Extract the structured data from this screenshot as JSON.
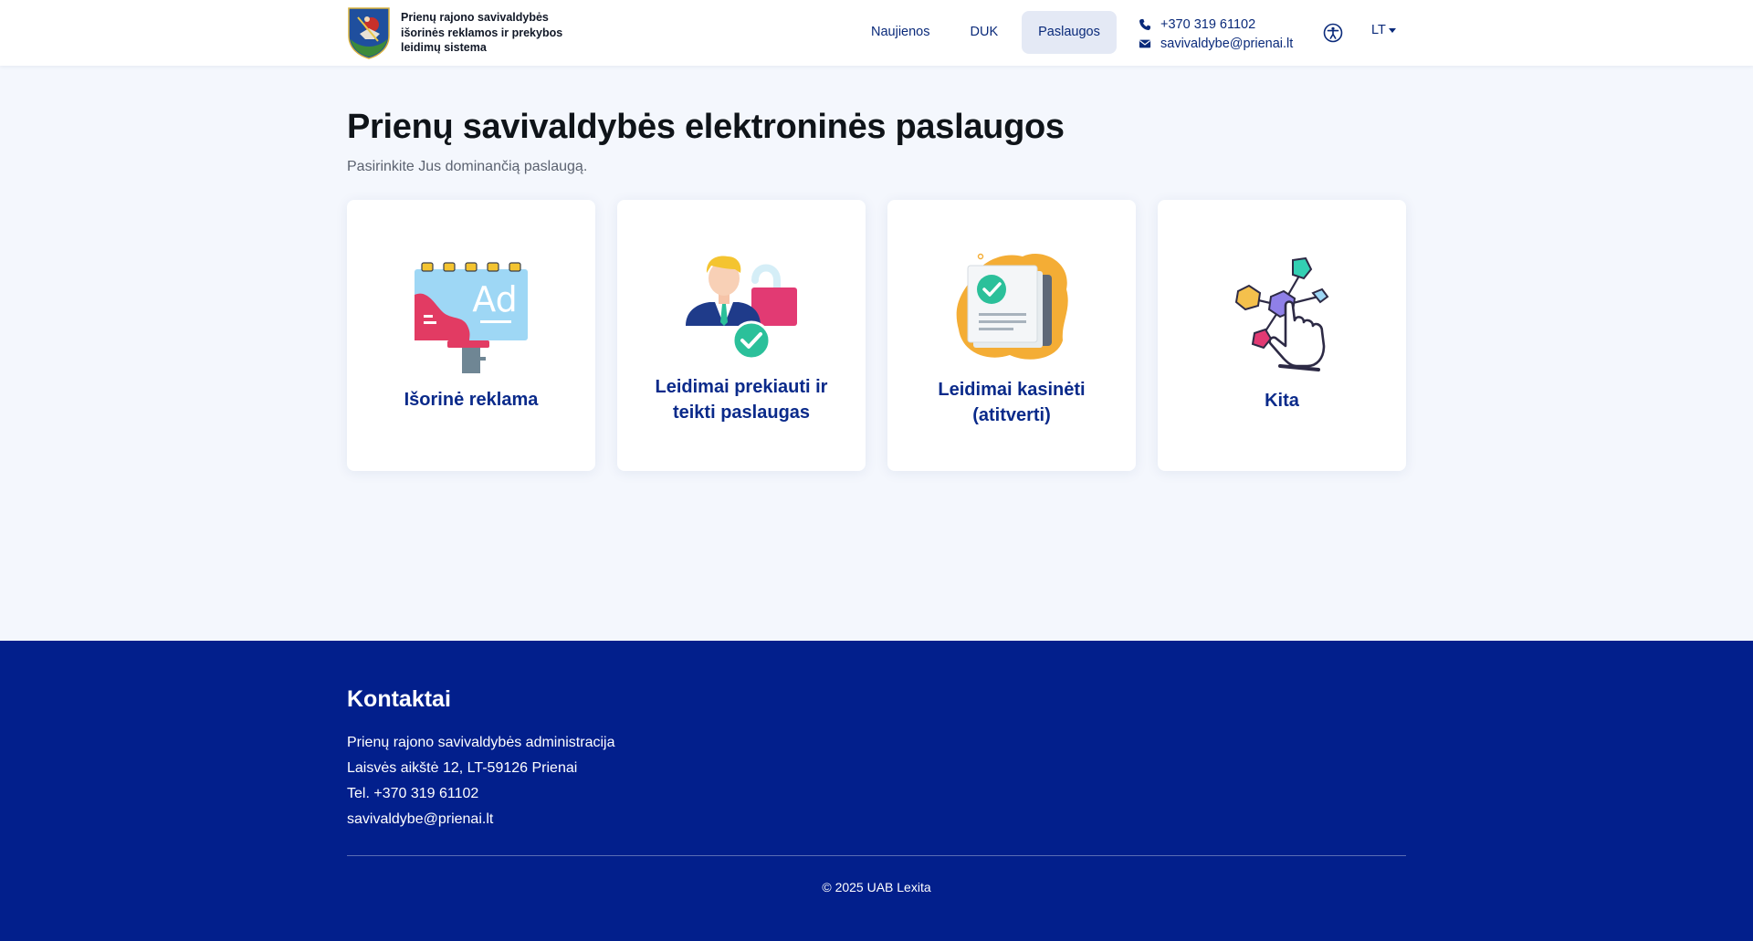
{
  "header": {
    "brand_text": "Prienų rajono savivaldybės išorinės reklamos ir prekybos leidimų sistema",
    "nav": [
      {
        "label": "Naujienos",
        "active": false
      },
      {
        "label": "DUK",
        "active": false
      },
      {
        "label": "Paslaugos",
        "active": true
      }
    ],
    "phone": "+370 319 61102",
    "email": "savivaldybe@prienai.lt",
    "language": "LT",
    "icons": [
      "crest-icon",
      "phone-icon",
      "envelope-icon",
      "accessibility-icon",
      "caret-down-icon"
    ]
  },
  "main": {
    "title": "Prienų savivaldybės elektroninės paslaugos",
    "subtitle": "Pasirinkite Jus dominančią paslaugą.",
    "cards": [
      {
        "label": "Išorinė reklama",
        "icon": "billboard-icon"
      },
      {
        "label": "Leidimai prekiauti ir teikti paslaugas",
        "icon": "person-unlocked-icon"
      },
      {
        "label": "Leidimai kasinėti (atitverti)",
        "icon": "approved-document-icon"
      },
      {
        "label": "Kita",
        "icon": "network-hand-icon"
      }
    ]
  },
  "footer": {
    "title": "Kontaktai",
    "lines": [
      "Prienų rajono savivaldybės administracija",
      "Laisvės aikštė 12, LT-59126 Prienai",
      "Tel. +370 319 61102",
      "savivaldybe@prienai.lt"
    ],
    "copyright": "© 2025 UAB Lexita"
  },
  "colors": {
    "primary": "#0a2a8a",
    "footer_bg": "#021f8c",
    "page_bg": "#f4f7fd",
    "active_nav_bg": "#e4e9f5"
  }
}
